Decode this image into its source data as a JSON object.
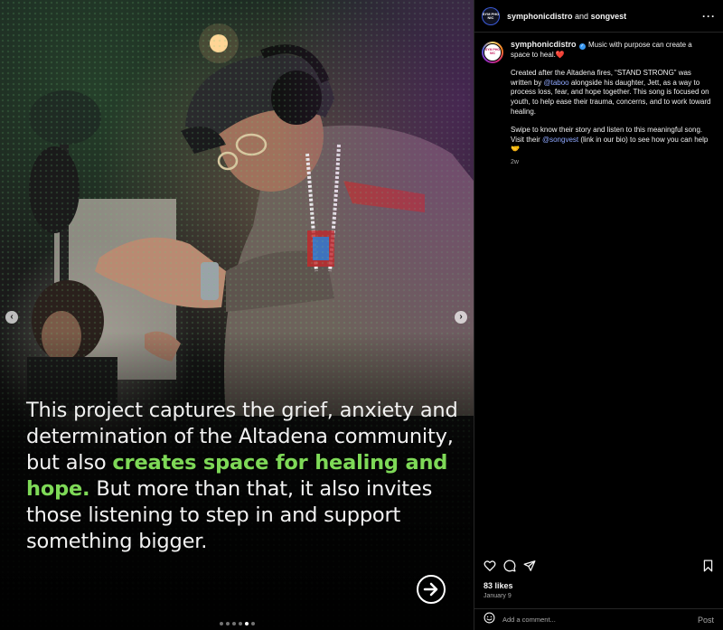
{
  "post": {
    "header": {
      "avatar_text": "SYM PHO NIC",
      "user_primary": "symphonicdistro",
      "joiner": "and",
      "user_collab": "songvest",
      "more_label": "···"
    },
    "media": {
      "overlay_part1": "This project captures the grief, anxiety and determination of the Altadena community, but also ",
      "overlay_highlight": "creates space for healing and hope.",
      "overlay_part2": " But more than that, it also invites those listening to step in and support something bigger.",
      "prev_glyph": "‹",
      "next_glyph": "›",
      "slide_count": 6,
      "active_slide": 4
    },
    "caption": {
      "avatar_text": "SYM PHO NIC",
      "username": "symphonicdistro",
      "verified_glyph": "✓",
      "intro": "Music with purpose can create a space to heal.",
      "intro_emoji": "❤️",
      "para1_a": "Created after the Altadena fires, “STAND STRONG” was written by ",
      "para1_mention": "@taboo",
      "para1_b": " alongside his daughter, Jett, as a way to process loss, fear, and hope together. This song is focused on youth, to help ease their trauma, concerns, and to work toward healing.",
      "para2_a": "Swipe to know their story and listen to this meaningful song. Visit their ",
      "para2_mention": "@songvest",
      "para2_b": " (link in our bio) to see how you can help ",
      "para2_emoji": "🤝",
      "time_ago": "2w"
    },
    "actions": {
      "like_icon": "heart-outline",
      "comment_icon": "speech-bubble",
      "share_icon": "paper-plane",
      "save_icon": "bookmark-outline"
    },
    "likes": "83 likes",
    "date": "January 9",
    "comment": {
      "placeholder": "Add a comment...",
      "post_label": "Post"
    }
  }
}
